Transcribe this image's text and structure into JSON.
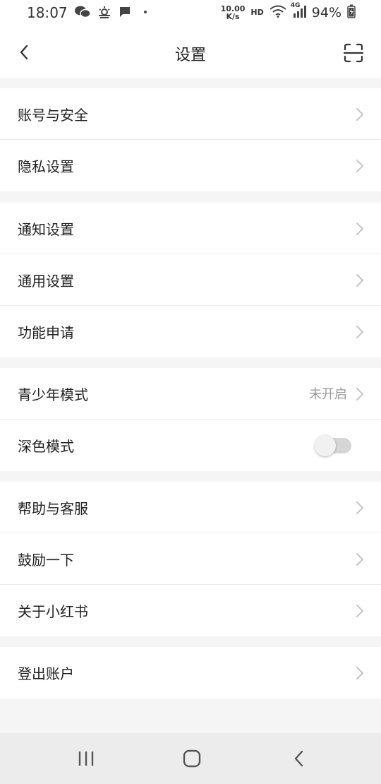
{
  "status_bar": {
    "time": "18:07",
    "net_speed_value": "10.00",
    "net_speed_unit": "K/s",
    "hd": "HD",
    "signal_type": "4G",
    "battery": "94%",
    "left_icons": [
      "wechat-icon",
      "weather-icon",
      "message-icon",
      "dot-icon"
    ]
  },
  "header": {
    "title": "设置"
  },
  "groups": [
    {
      "items": [
        {
          "label": "账号与安全"
        },
        {
          "label": "隐私设置"
        }
      ]
    },
    {
      "items": [
        {
          "label": "通知设置"
        },
        {
          "label": "通用设置"
        },
        {
          "label": "功能申请"
        }
      ]
    },
    {
      "items": [
        {
          "label": "青少年模式",
          "value": "未开启"
        },
        {
          "label": "深色模式",
          "toggle": false
        }
      ]
    },
    {
      "items": [
        {
          "label": "帮助与客服"
        },
        {
          "label": "鼓励一下"
        },
        {
          "label": "关于小红书"
        }
      ]
    },
    {
      "items": [
        {
          "label": "登出账户"
        }
      ]
    }
  ],
  "nav_bar": {
    "buttons": [
      "recent-apps-icon",
      "home-icon",
      "back-icon"
    ]
  },
  "colors": {
    "background": "#f5f5f5",
    "card": "#ffffff",
    "text": "#222222",
    "secondary_text": "#999999",
    "chevron": "#c4c4c4",
    "toggle_off": "#d6d6d6"
  }
}
